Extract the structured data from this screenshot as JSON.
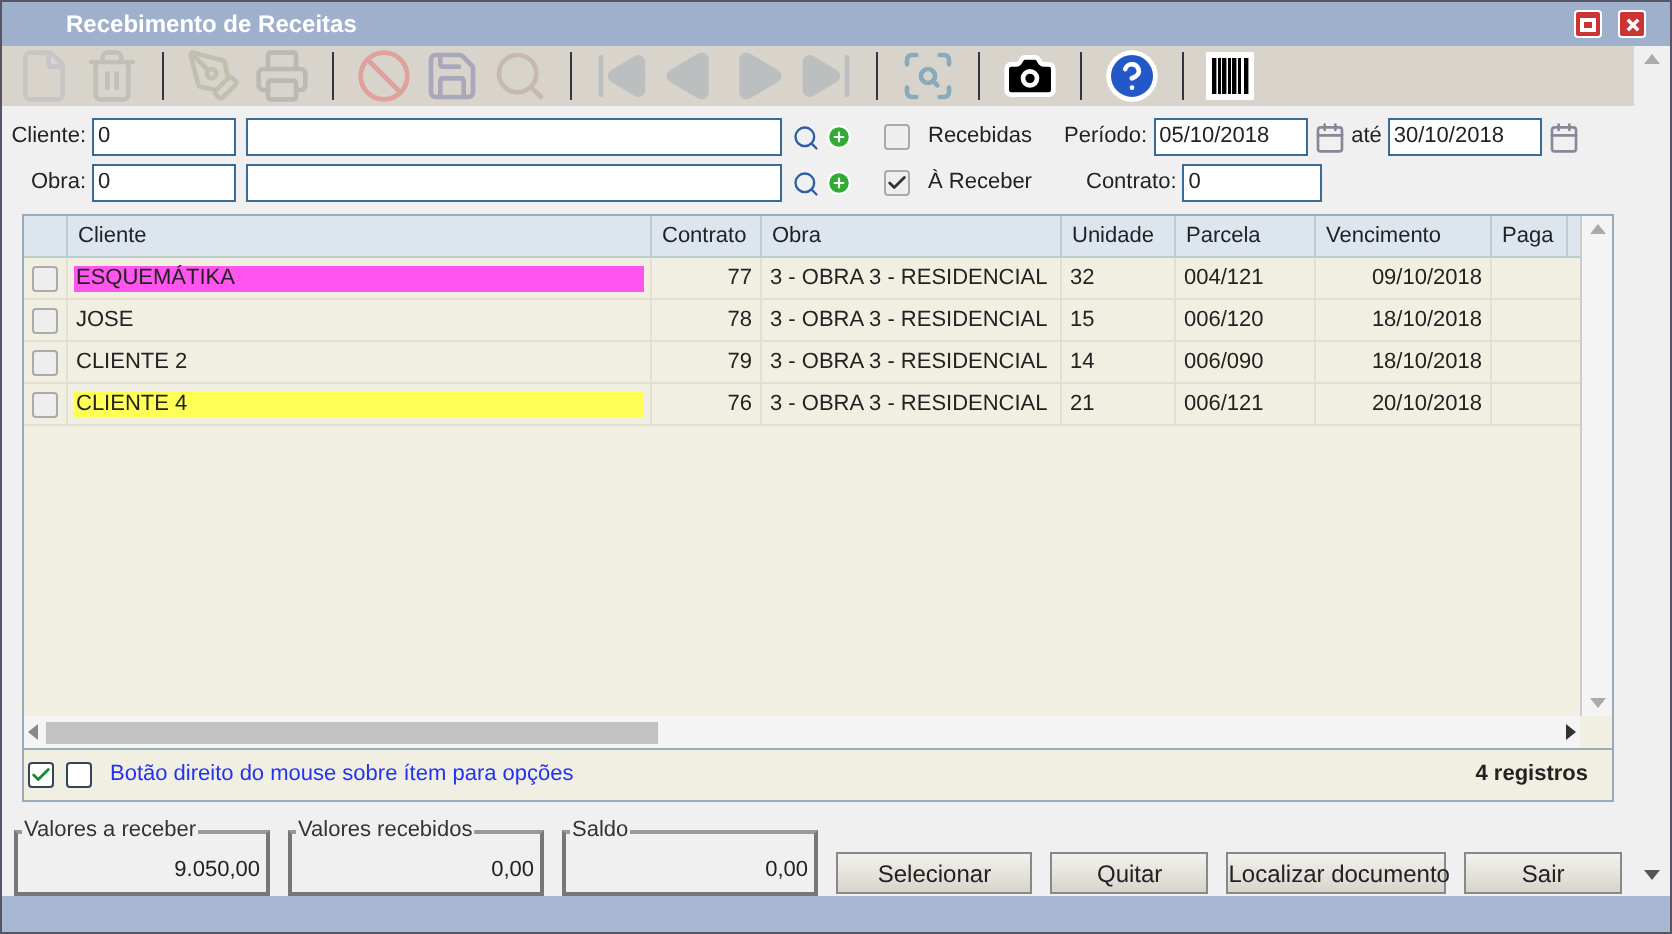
{
  "window": {
    "title": "Recebimento de Receitas"
  },
  "toolbar": [
    {
      "kind": "new",
      "disabled": true
    },
    {
      "kind": "delete",
      "disabled": true
    },
    {
      "kind": "separator"
    },
    {
      "kind": "edit",
      "disabled": true
    },
    {
      "kind": "print",
      "disabled": true
    },
    {
      "kind": "separator"
    },
    {
      "kind": "cancel",
      "disabled": true
    },
    {
      "kind": "save",
      "disabled": true
    },
    {
      "kind": "find",
      "disabled": true
    },
    {
      "kind": "separator"
    },
    {
      "kind": "first",
      "disabled": true
    },
    {
      "kind": "prev",
      "disabled": true
    },
    {
      "kind": "next",
      "disabled": true
    },
    {
      "kind": "last",
      "disabled": true
    },
    {
      "kind": "separator"
    },
    {
      "kind": "preview",
      "disabled": false
    },
    {
      "kind": "separator"
    },
    {
      "kind": "camera",
      "disabled": false
    },
    {
      "kind": "separator"
    },
    {
      "kind": "help",
      "disabled": false
    },
    {
      "kind": "separator"
    },
    {
      "kind": "barcode",
      "disabled": false
    }
  ],
  "filters": {
    "cliente": {
      "label": "Cliente:",
      "code": "0"
    },
    "obra": {
      "label": "Obra:",
      "code": "0"
    },
    "recebidas": {
      "label": "Recebidas",
      "checked": false
    },
    "a_receber": {
      "label": "À Receber",
      "checked": true
    },
    "periodo": {
      "label": "Período:",
      "from": "05/10/2018",
      "to_label": "até",
      "to": "30/10/2018"
    },
    "contrato": {
      "label": "Contrato:",
      "value": "0"
    }
  },
  "table": {
    "columns": [
      "Cliente",
      "Contrato",
      "Obra",
      "Unidade",
      "Parcela",
      "Vencimento",
      "Paga"
    ],
    "rows": [
      {
        "checked": false,
        "color": "#ff55ee",
        "cells": [
          "ESQUEMÁTIKA",
          "77",
          "3 - OBRA 3 - RESIDENCIAL",
          "32",
          "004/121",
          "09/10/2018"
        ]
      },
      {
        "checked": false,
        "cells": [
          "JOSE",
          "78",
          "3 - OBRA 3 - RESIDENCIAL",
          "15",
          "006/120",
          "18/10/2018"
        ]
      },
      {
        "checked": false,
        "cells": [
          "CLIENTE 2",
          "79",
          "3 - OBRA 3 - RESIDENCIAL",
          "14",
          "006/090",
          "18/10/2018"
        ]
      },
      {
        "checked": false,
        "color": "#ffff55",
        "cells": [
          "CLIENTE 4",
          "76",
          "3 - OBRA 3 - RESIDENCIAL",
          "21",
          "006/121",
          "20/10/2018"
        ]
      }
    ]
  },
  "footer": {
    "select_all": {
      "checked": true
    },
    "option": {
      "checked": false
    },
    "hint": "Botão direito do mouse sobre ítem para opções",
    "count": "4 registros"
  },
  "totals": [
    {
      "label": "Valores a receber",
      "value": "9.050,00"
    },
    {
      "label": "Valores recebidos",
      "value": "0,00"
    },
    {
      "label": "Saldo",
      "value": "0,00"
    }
  ],
  "buttons": [
    "Selecionar",
    "Quitar",
    "Localizar documento",
    "Sair"
  ]
}
